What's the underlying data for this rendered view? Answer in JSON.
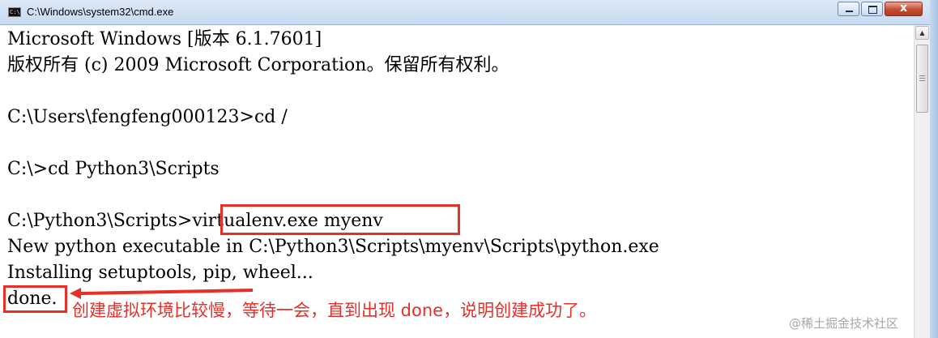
{
  "window": {
    "title": "C:\\Windows\\system32\\cmd.exe",
    "icon_text": "C:\\",
    "close_label": "x"
  },
  "console": {
    "lines": [
      "Microsoft Windows [版本 6.1.7601]",
      "版权所有 (c) 2009 Microsoft Corporation。保留所有权利。",
      "",
      "C:\\Users\\fengfeng000123>cd /",
      "",
      "C:\\>cd Python3\\Scripts",
      "",
      "C:\\Python3\\Scripts>virtualenv.exe myenv",
      "New python executable in C:\\Python3\\Scripts\\myenv\\Scripts\\python.exe",
      "Installing setuptools, pip, wheel...",
      "done."
    ]
  },
  "annotation": {
    "text": "创建虚拟环境比较慢，等待一会，直到出现 done，说明创建成功了。",
    "color": "#e5302a"
  },
  "watermark": {
    "text": "@稀土掘金技术社区"
  },
  "scrollbar": {
    "up_arrow": "▲"
  },
  "colors": {
    "console_bg": "#ffffff",
    "console_text": "#000000",
    "highlight": "#e5302a"
  }
}
